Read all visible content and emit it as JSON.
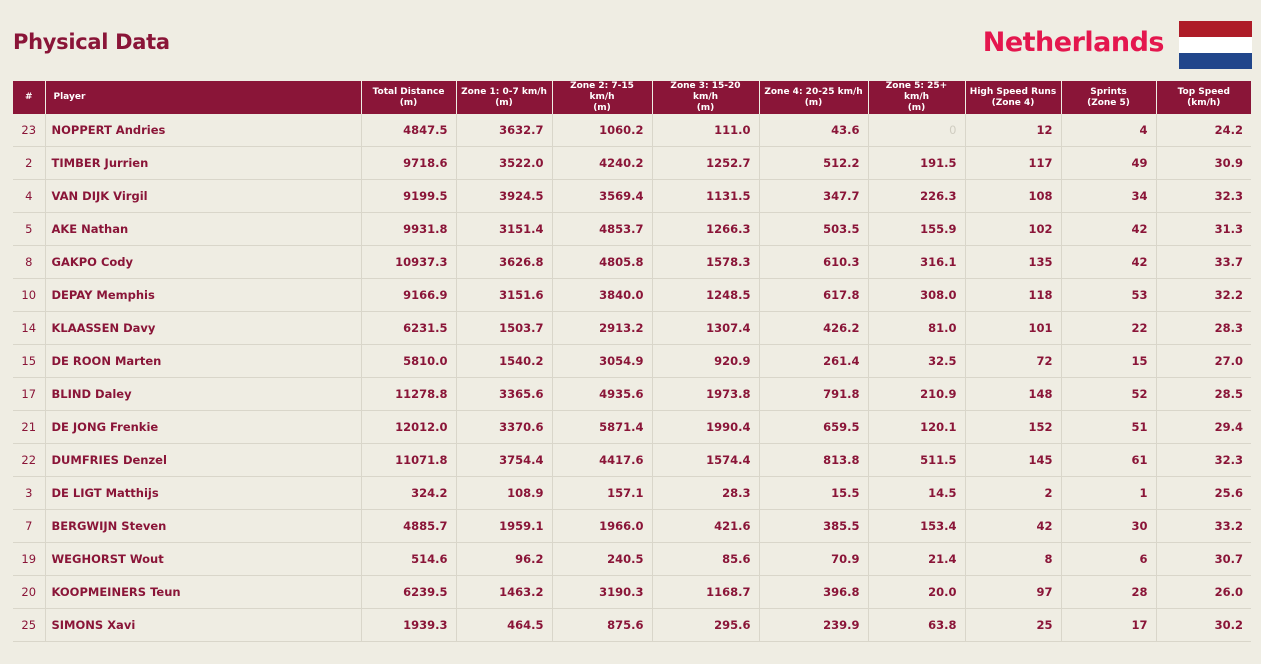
{
  "page": {
    "title": "Physical Data",
    "team": "Netherlands"
  },
  "colors": {
    "primary": "#8a1538",
    "accent": "#e4174e",
    "background": "#efede3"
  },
  "flag": {
    "colors": [
      "#ae1c28",
      "#ffffff",
      "#21468b"
    ]
  },
  "table": {
    "columns": [
      [
        "#"
      ],
      [
        "Player"
      ],
      [
        "Total Distance",
        "(m)"
      ],
      [
        "Zone 1: 0-7 km/h",
        "(m)"
      ],
      [
        "Zone 2: 7-15 km/h",
        "(m)"
      ],
      [
        "Zone 3: 15-20 km/h",
        "(m)"
      ],
      [
        "Zone 4: 20-25 km/h",
        "(m)"
      ],
      [
        "Zone 5: 25+ km/h",
        "(m)"
      ],
      [
        "High Speed Runs",
        "(Zone 4)"
      ],
      [
        "Sprints",
        "(Zone 5)"
      ],
      [
        "Top Speed",
        "(km/h)"
      ]
    ],
    "rows": [
      [
        "23",
        "NOPPERT Andries",
        "4847.5",
        "3632.7",
        "1060.2",
        "111.0",
        "43.6",
        "0",
        "12",
        "4",
        "24.2"
      ],
      [
        "2",
        "TIMBER Jurrien",
        "9718.6",
        "3522.0",
        "4240.2",
        "1252.7",
        "512.2",
        "191.5",
        "117",
        "49",
        "30.9"
      ],
      [
        "4",
        "VAN DIJK Virgil",
        "9199.5",
        "3924.5",
        "3569.4",
        "1131.5",
        "347.7",
        "226.3",
        "108",
        "34",
        "32.3"
      ],
      [
        "5",
        "AKE Nathan",
        "9931.8",
        "3151.4",
        "4853.7",
        "1266.3",
        "503.5",
        "155.9",
        "102",
        "42",
        "31.3"
      ],
      [
        "8",
        "GAKPO Cody",
        "10937.3",
        "3626.8",
        "4805.8",
        "1578.3",
        "610.3",
        "316.1",
        "135",
        "42",
        "33.7"
      ],
      [
        "10",
        "DEPAY Memphis",
        "9166.9",
        "3151.6",
        "3840.0",
        "1248.5",
        "617.8",
        "308.0",
        "118",
        "53",
        "32.2"
      ],
      [
        "14",
        "KLAASSEN Davy",
        "6231.5",
        "1503.7",
        "2913.2",
        "1307.4",
        "426.2",
        "81.0",
        "101",
        "22",
        "28.3"
      ],
      [
        "15",
        "DE ROON Marten",
        "5810.0",
        "1540.2",
        "3054.9",
        "920.9",
        "261.4",
        "32.5",
        "72",
        "15",
        "27.0"
      ],
      [
        "17",
        "BLIND Daley",
        "11278.8",
        "3365.6",
        "4935.6",
        "1973.8",
        "791.8",
        "210.9",
        "148",
        "52",
        "28.5"
      ],
      [
        "21",
        "DE JONG Frenkie",
        "12012.0",
        "3370.6",
        "5871.4",
        "1990.4",
        "659.5",
        "120.1",
        "152",
        "51",
        "29.4"
      ],
      [
        "22",
        "DUMFRIES Denzel",
        "11071.8",
        "3754.4",
        "4417.6",
        "1574.4",
        "813.8",
        "511.5",
        "145",
        "61",
        "32.3"
      ],
      [
        "3",
        "DE LIGT Matthijs",
        "324.2",
        "108.9",
        "157.1",
        "28.3",
        "15.5",
        "14.5",
        "2",
        "1",
        "25.6"
      ],
      [
        "7",
        "BERGWIJN Steven",
        "4885.7",
        "1959.1",
        "1966.0",
        "421.6",
        "385.5",
        "153.4",
        "42",
        "30",
        "33.2"
      ],
      [
        "19",
        "WEGHORST Wout",
        "514.6",
        "96.2",
        "240.5",
        "85.6",
        "70.9",
        "21.4",
        "8",
        "6",
        "30.7"
      ],
      [
        "20",
        "KOOPMEINERS Teun",
        "6239.5",
        "1463.2",
        "3190.3",
        "1168.7",
        "396.8",
        "20.0",
        "97",
        "28",
        "26.0"
      ],
      [
        "25",
        "SIMONS Xavi",
        "1939.3",
        "464.5",
        "875.6",
        "295.6",
        "239.9",
        "63.8",
        "25",
        "17",
        "30.2"
      ]
    ]
  }
}
